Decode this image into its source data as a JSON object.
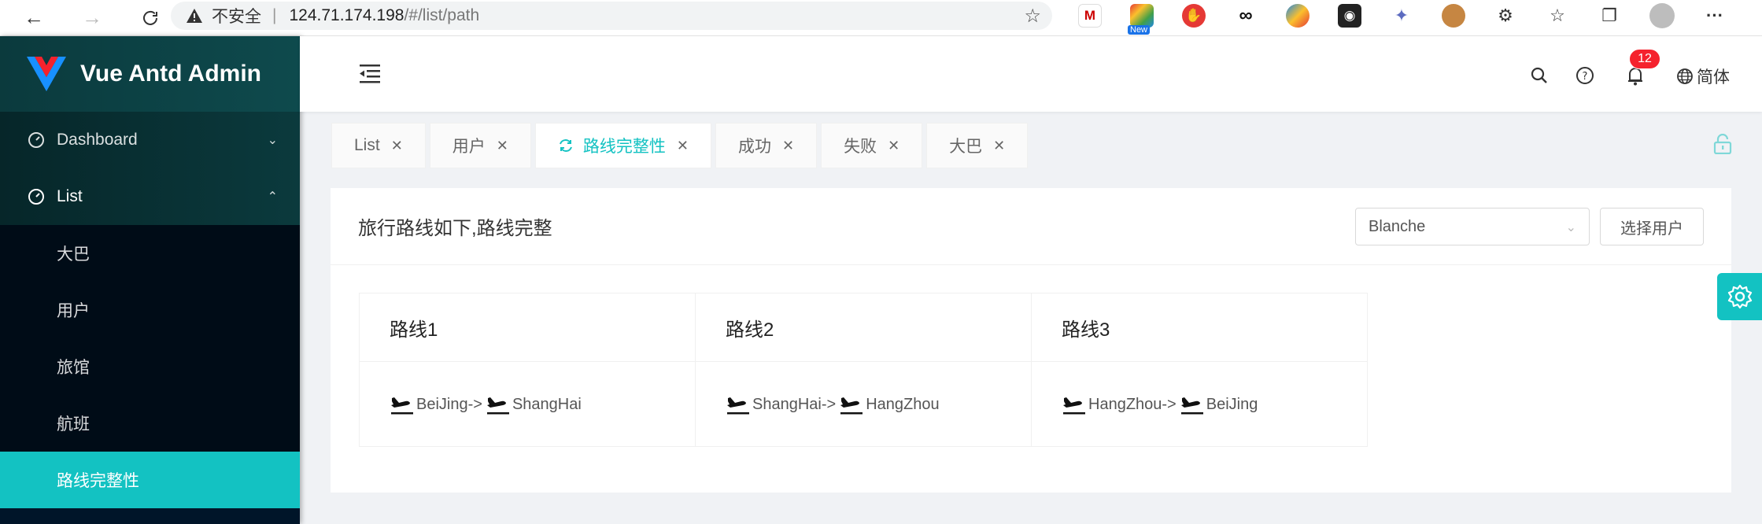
{
  "browser": {
    "insecure_label": "不安全",
    "url_host": "124.71.174.198",
    "url_path": "/#/list/path",
    "ext_new_badge": "New"
  },
  "app": {
    "title": "Vue Antd Admin"
  },
  "sidebar": {
    "items": [
      {
        "label": "Dashboard"
      },
      {
        "label": "List"
      }
    ],
    "sub_items": [
      {
        "label": "大巴"
      },
      {
        "label": "用户"
      },
      {
        "label": "旅馆"
      },
      {
        "label": "航班"
      },
      {
        "label": "路线完整性"
      }
    ]
  },
  "header": {
    "notification_count": "12",
    "language": "简体"
  },
  "tabs": [
    {
      "label": "List"
    },
    {
      "label": "用户"
    },
    {
      "label": "路线完整性"
    },
    {
      "label": "成功"
    },
    {
      "label": "失败"
    },
    {
      "label": "大巴"
    }
  ],
  "card": {
    "title": "旅行路线如下,路线完整",
    "select_value": "Blanche",
    "choose_button": "选择用户",
    "routes": [
      {
        "title": "路线1",
        "from": "BeiJing->",
        "to": "ShangHai"
      },
      {
        "title": "路线2",
        "from": "ShangHai->",
        "to": "HangZhou"
      },
      {
        "title": "路线3",
        "from": "HangZhou->",
        "to": "BeiJing"
      }
    ]
  },
  "colors": {
    "accent": "#13c2c2",
    "sidebar": "#001529",
    "badge": "#f5222d"
  }
}
